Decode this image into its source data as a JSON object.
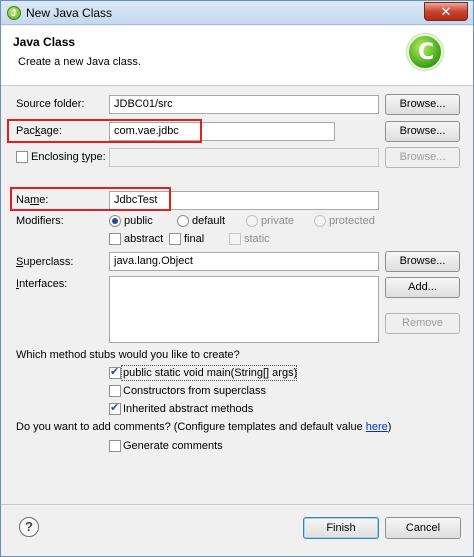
{
  "window": {
    "title": "New Java Class",
    "close_glyph": "✕"
  },
  "header": {
    "title": "Java Class",
    "description": "Create a new Java class.",
    "icon_letter": "C"
  },
  "form": {
    "source_folder": {
      "label": "Source folder:",
      "value": "JDBC01/src",
      "button": "Browse..."
    },
    "package": {
      "label_pre": "Pac",
      "label_ul": "k",
      "label_post": "age:",
      "value": "com.vae.jdbc",
      "button": "Browse..."
    },
    "enclosing": {
      "label_pre": "Enclosing ",
      "label_ul": "t",
      "label_post": "ype:",
      "value": "",
      "button": "Browse..."
    },
    "name": {
      "label_pre": "Na",
      "label_ul": "m",
      "label_post": "e:",
      "value": "JdbcTest"
    },
    "modifiers": {
      "label": "Modifiers:",
      "public": "public",
      "default": "default",
      "private": "private",
      "protected": "protected",
      "abstract": "abstract",
      "final": "final",
      "static": "static"
    },
    "superclass": {
      "label_pre": "",
      "label_ul": "S",
      "label_post": "uperclass:",
      "value": "java.lang.Object",
      "button": "Browse..."
    },
    "interfaces": {
      "label_pre": "",
      "label_ul": "I",
      "label_post": "nterfaces:",
      "add_button": "Add...",
      "remove_button": "Remove"
    }
  },
  "stubs": {
    "question": "Which method stubs would you like to create?",
    "main": "public static void main(String[] args)",
    "constructors": "Constructors from superclass",
    "inherited": "Inherited abstract methods"
  },
  "comments": {
    "question": "Do you want to add comments? (Configure templates and default value ",
    "link": "here",
    "question_end": ")",
    "generate": "Generate comments"
  },
  "footer": {
    "help_glyph": "?",
    "finish": "Finish",
    "cancel": "Cancel"
  }
}
